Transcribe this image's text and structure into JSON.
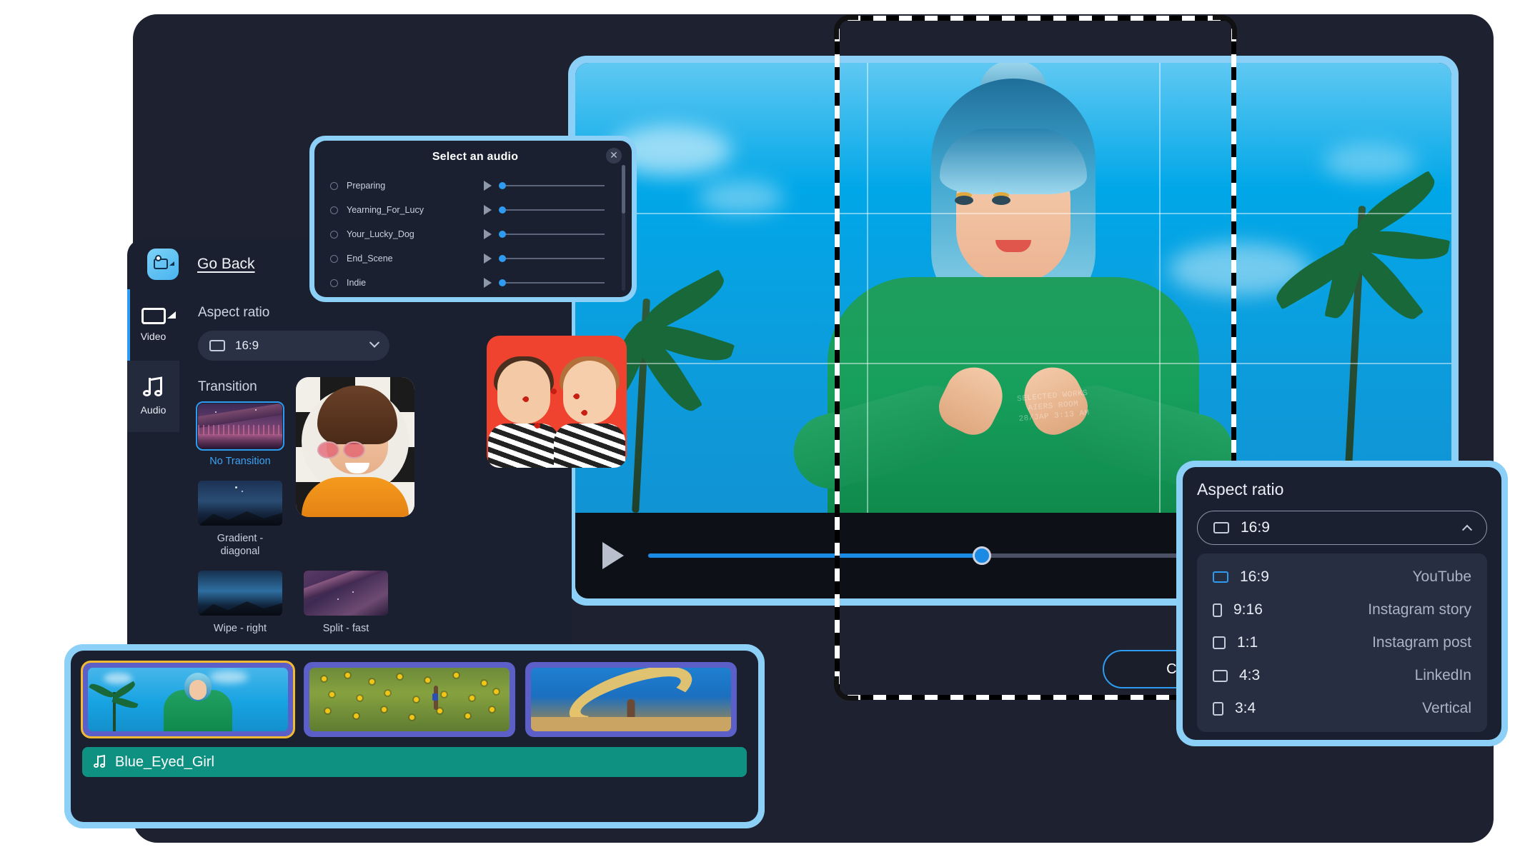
{
  "app": {
    "go_back_label": "Go Back",
    "logo_icon": "video-camera-logo-icon"
  },
  "sidebar": {
    "items": [
      {
        "label": "Video",
        "icon": "video-camera-icon",
        "active": true
      },
      {
        "label": "Audio",
        "icon": "music-note-icon",
        "active": false
      }
    ]
  },
  "editor": {
    "aspect_ratio_section_title": "Aspect ratio",
    "aspect_ratio_value": "16:9",
    "aspect_ratio_icon": "rectangle-landscape-icon",
    "chevron_icon": "chevron-down-icon",
    "transition_section_title": "Transition",
    "transitions": [
      {
        "label": "No Transition",
        "selected": true
      },
      {
        "label": "Gradient - diagonal",
        "selected": false
      },
      {
        "label": "Wipe - right",
        "selected": false
      },
      {
        "label": "Split - fast",
        "selected": false
      }
    ]
  },
  "audio_modal": {
    "title": "Select an audio",
    "close_icon": "close-icon",
    "play_icon": "play-icon",
    "tracks": [
      {
        "name": "Preparing"
      },
      {
        "name": "Yearning_For_Lucy"
      },
      {
        "name": "Your_Lucky_Dog"
      },
      {
        "name": "End_Scene"
      },
      {
        "name": "Indie"
      }
    ]
  },
  "aspect_panel": {
    "title": "Aspect ratio",
    "selected_value": "16:9",
    "chevron_icon": "chevron-up-icon",
    "options": [
      {
        "ratio": "16:9",
        "platform": "YouTube",
        "orientation": "landscape",
        "selected": true
      },
      {
        "ratio": "9:16",
        "platform": "Instagram story",
        "orientation": "portrait",
        "selected": false
      },
      {
        "ratio": "1:1",
        "platform": "Instagram post",
        "orientation": "square",
        "selected": false
      },
      {
        "ratio": "4:3",
        "platform": "LinkedIn",
        "orientation": "landscape",
        "selected": false
      },
      {
        "ratio": "3:4",
        "platform": "Vertical",
        "orientation": "portrait",
        "selected": false
      }
    ]
  },
  "player": {
    "play_icon": "play-icon",
    "progress_percent": 43
  },
  "actions": {
    "continue_label": "Continue"
  },
  "timeline": {
    "clips": [
      {
        "name": "clip-girl-heart-hands",
        "selected": true
      },
      {
        "name": "clip-sunflower-field",
        "selected": false
      },
      {
        "name": "clip-smoke-dancer",
        "selected": false
      }
    ],
    "audio_track": {
      "label": "Blue_Eyed_Girl",
      "icon": "music-note-icon"
    }
  },
  "colors": {
    "accent_blue": "#2f9bf0",
    "panel_border_blue": "#8cd0f8",
    "panel_bg": "#1b2030",
    "app_bg": "#1e2230",
    "clip_bg": "#5b5fc7",
    "audio_track_green": "#0f9182",
    "selection_yellow": "#f2b933",
    "sky_blue": "#00a7e8"
  }
}
